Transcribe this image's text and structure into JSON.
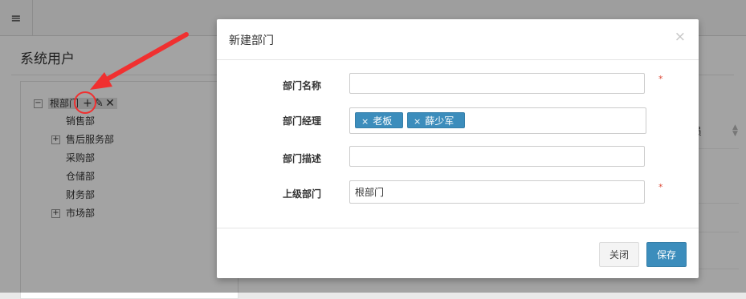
{
  "topbar": {
    "menu_icon": "hamburger-icon",
    "menu_glyph": "≡"
  },
  "page": {
    "title": "系统用户",
    "table_header_partial": "员"
  },
  "tree": {
    "root": {
      "label": "根部门",
      "expand_glyph": "−",
      "tools": [
        {
          "icon": "plus-icon",
          "glyph": "+"
        },
        {
          "icon": "edit-icon",
          "glyph": "✎"
        },
        {
          "icon": "delete-icon",
          "glyph": "✕"
        }
      ]
    },
    "children": [
      {
        "label": "销售部",
        "expandable": false
      },
      {
        "label": "售后服务部",
        "expandable": true,
        "glyph": "+"
      },
      {
        "label": "采购部",
        "expandable": false
      },
      {
        "label": "仓储部",
        "expandable": false
      },
      {
        "label": "财务部",
        "expandable": false
      },
      {
        "label": "市场部",
        "expandable": true,
        "glyph": "+"
      }
    ]
  },
  "modal": {
    "title": "新建部门",
    "close_glyph": "×",
    "fields": {
      "name": {
        "label": "部门名称",
        "value": "",
        "required_mark": "*"
      },
      "manager": {
        "label": "部门经理",
        "tags": [
          {
            "remove_glyph": "×",
            "text": "老板"
          },
          {
            "remove_glyph": "×",
            "text": "薛少军"
          }
        ]
      },
      "description": {
        "label": "部门描述",
        "value": ""
      },
      "parent": {
        "label": "上级部门",
        "value": "根部门",
        "required_mark": "*"
      }
    },
    "buttons": {
      "close": "关闭",
      "save": "保存"
    }
  },
  "colors": {
    "primary": "#3c8dbc",
    "required": "#dd4b39",
    "annotation": "#f03030"
  }
}
